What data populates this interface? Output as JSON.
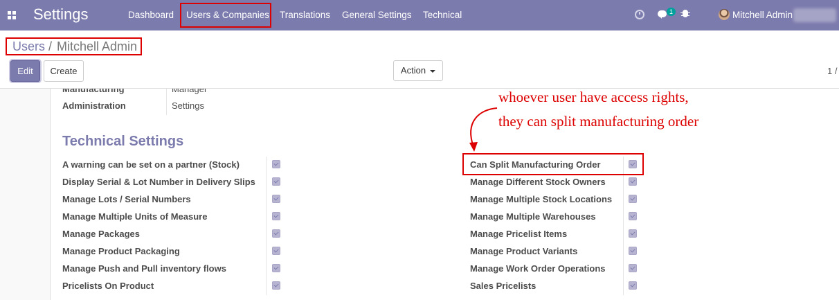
{
  "navbar": {
    "app_title": "Settings",
    "menu": [
      "Dashboard",
      "Users & Companies",
      "Translations",
      "General Settings",
      "Technical"
    ],
    "chat_badge": "1",
    "user_name": "Mitchell Admin",
    "icons": [
      "apps-grid-icon",
      "clock-icon",
      "chat-icon",
      "bug-icon"
    ]
  },
  "breadcrumb": {
    "parent": "Users",
    "separator": "/",
    "current": "Mitchell Admin"
  },
  "buttons": {
    "edit": "Edit",
    "create": "Create",
    "action": "Action"
  },
  "pager": "1 /",
  "top_fields": [
    {
      "label": "Manufacturing",
      "value": "Manager"
    },
    {
      "label": "Administration",
      "value": "Settings"
    }
  ],
  "section_title": "Technical Settings",
  "left_settings": [
    "A warning can be set on a partner (Stock)",
    "Display Serial & Lot Number in Delivery Slips",
    "Manage Lots / Serial Numbers",
    "Manage Multiple Units of Measure",
    "Manage Packages",
    "Manage Product Packaging",
    "Manage Push and Pull inventory flows",
    "Pricelists On Product"
  ],
  "right_settings": [
    "Can Split Manufacturing Order",
    "Manage Different Stock Owners",
    "Manage Multiple Stock Locations",
    "Manage Multiple Warehouses",
    "Manage Pricelist Items",
    "Manage Product Variants",
    "Manage Work Order Operations",
    "Sales Pricelists"
  ],
  "annotation": {
    "line1": "whoever user have access rights,",
    "line2": "they can split manufacturing order",
    "color": "#dd0000"
  },
  "colors": {
    "navbar": "#7c7bad",
    "accent": "#7c7bad",
    "highlight": "#dd0000"
  }
}
